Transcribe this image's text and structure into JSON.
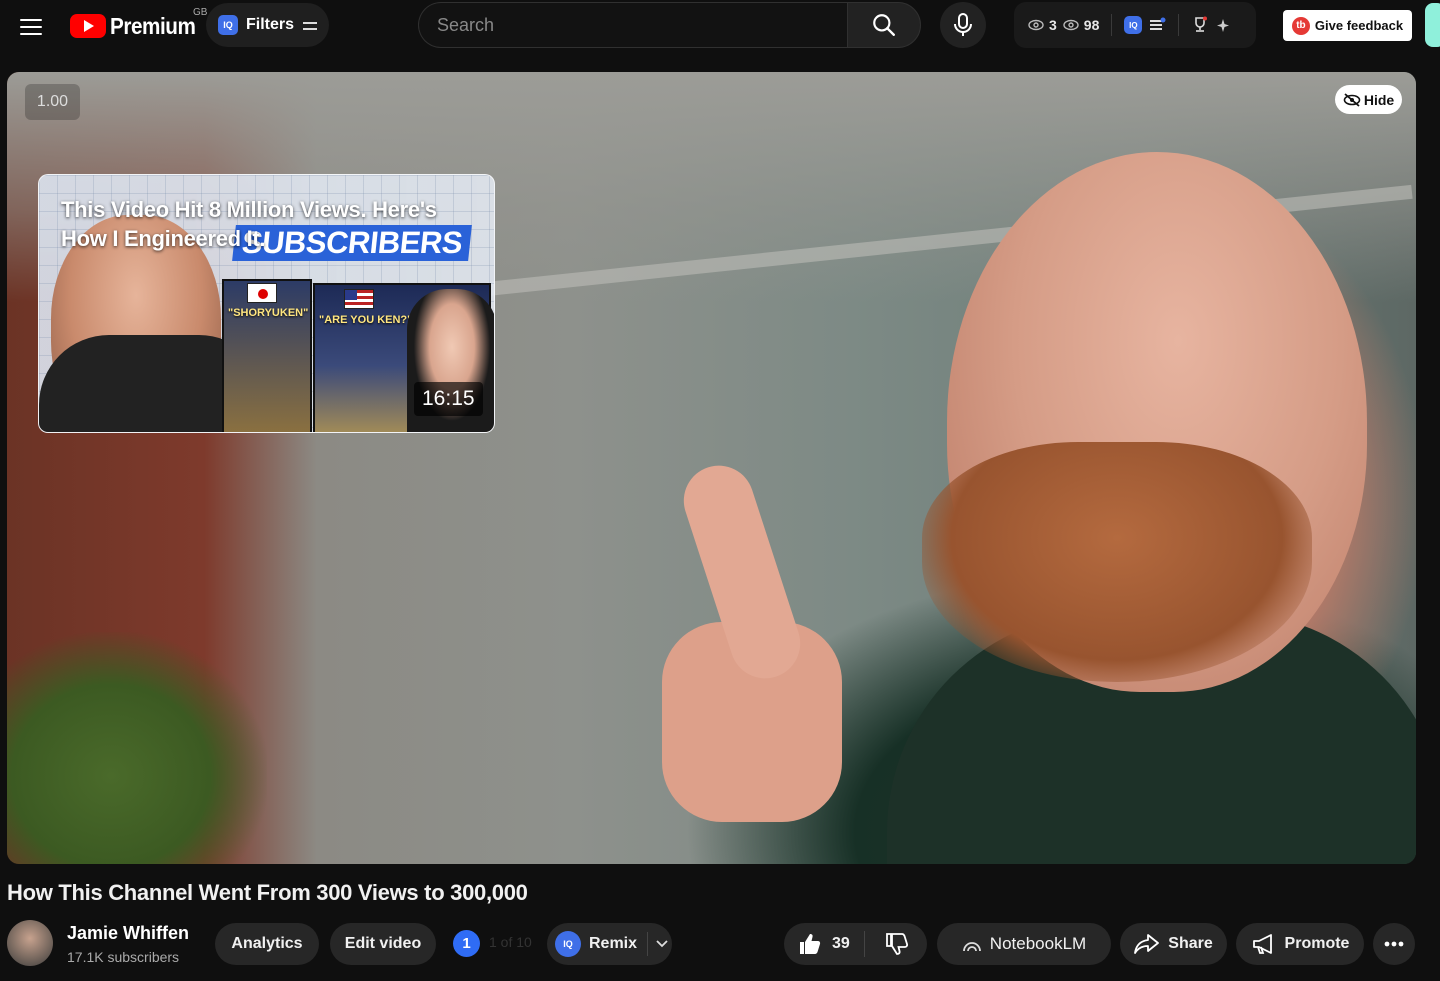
{
  "header": {
    "logo_text": "Premium",
    "country_code": "GB",
    "filters_label": "Filters",
    "iq_label": "IQ",
    "search_placeholder": "Search",
    "stats": {
      "views_a": "3",
      "views_b": "98"
    },
    "feedback_label": "Give feedback"
  },
  "player": {
    "speed": "1.00",
    "hide_label": "Hide",
    "thumbnail": {
      "title": "This Video Hit 8 Million Views. Here's How I Engineered It.",
      "overlay_text": "SUBSCRIBERS",
      "quote_left": "\"SHORYUKEN\"",
      "quote_right": "\"ARE YOU KEN?\"",
      "duration": "16:15"
    }
  },
  "video": {
    "title": "How This Channel Went From 300 Views to 300,000",
    "channel_name": "Jamie Whiffen",
    "subscribers": "17.1K subscribers",
    "buttons": {
      "analytics": "Analytics",
      "edit": "Edit video",
      "badge_number": "1",
      "badge_text": "1 of 10",
      "remix": "Remix",
      "likes": "39",
      "notebook": "NotebookLM",
      "share": "Share",
      "promote": "Promote"
    }
  },
  "colors": {
    "accent": "#ff0000",
    "iq_blue": "#3f6fe8",
    "background": "#0f0f0f"
  }
}
